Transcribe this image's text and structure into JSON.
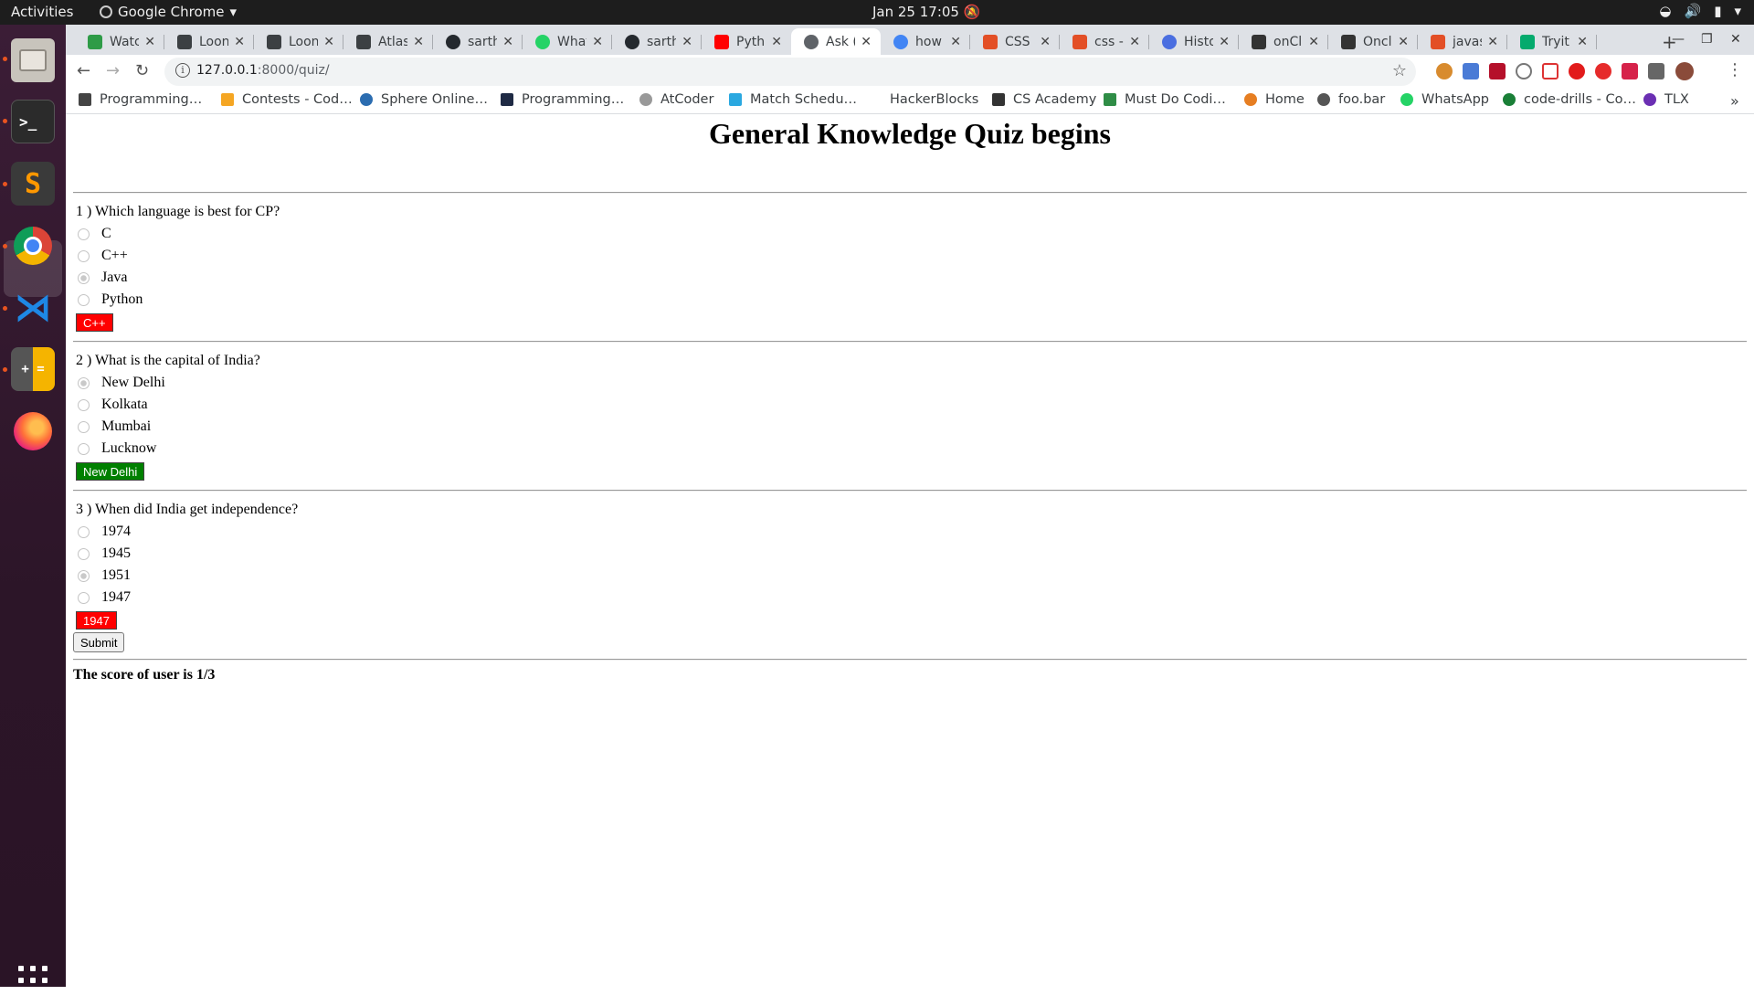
{
  "system": {
    "activities": "Activities",
    "app_name": "Google Chrome",
    "clock": "Jan 25  17:05"
  },
  "tabs": [
    {
      "title": "Watc",
      "color": "#2e9b47"
    },
    {
      "title": "Loon",
      "color": "#3c4043"
    },
    {
      "title": "Loon",
      "color": "#3c4043"
    },
    {
      "title": "Atlas",
      "color": "#3c4043"
    },
    {
      "title": "sarth",
      "color": "#24292e"
    },
    {
      "title": "What",
      "color": "#25d366"
    },
    {
      "title": "sarth",
      "color": "#24292e"
    },
    {
      "title": "Pyth",
      "color": "#ff0000"
    },
    {
      "title": "Ask (",
      "color": "#5f6368"
    },
    {
      "title": "how",
      "color": "#4285f4"
    },
    {
      "title": "CSS c",
      "color": "#e34f26"
    },
    {
      "title": "css -",
      "color": "#e34f26"
    },
    {
      "title": "Histo",
      "color": "#4a6ee0"
    },
    {
      "title": "onCl",
      "color": "#333333"
    },
    {
      "title": "Oncl",
      "color": "#333333"
    },
    {
      "title": "javas",
      "color": "#e34f26"
    },
    {
      "title": "Tryit",
      "color": "#04aa6d"
    }
  ],
  "address": {
    "host": "127.0.0.1",
    "rest": ":8000/quiz/"
  },
  "bookmarks": [
    {
      "label": "Programming…",
      "color": "#444"
    },
    {
      "label": "Contests - Cod…",
      "color": "#f5a623"
    },
    {
      "label": "Sphere Online…",
      "color": "#2b6cb0"
    },
    {
      "label": "Programming…",
      "color": "#1f2a44"
    },
    {
      "label": "AtCoder",
      "color": "#777"
    },
    {
      "label": "Match Schedu…",
      "color": "#2aa8e0"
    },
    {
      "label": "HackerBlocks",
      "color": "#ffffff"
    },
    {
      "label": "CS Academy",
      "color": "#333"
    },
    {
      "label": "Must Do Codi…",
      "color": "#2f8d46"
    },
    {
      "label": "Home",
      "color": "#e67e22"
    },
    {
      "label": "foo.bar",
      "color": "#555"
    },
    {
      "label": "WhatsApp",
      "color": "#25d366"
    },
    {
      "label": "code-drills - Co…",
      "color": "#1a7f37"
    },
    {
      "label": "TLX",
      "color": "#6b2fb3"
    }
  ],
  "quiz": {
    "heading": "General Knowledge Quiz begins",
    "questions": [
      {
        "text": "1 ) Which language is best for CP?",
        "options": [
          "C",
          "C++",
          "Java",
          "Python"
        ],
        "selected": 2,
        "answer": "C++",
        "correct": false
      },
      {
        "text": "2 ) What is the capital of India?",
        "options": [
          "New Delhi",
          "Kolkata",
          "Mumbai",
          "Lucknow"
        ],
        "selected": 0,
        "answer": "New Delhi",
        "correct": true
      },
      {
        "text": "3 ) When did India get independence?",
        "options": [
          "1974",
          "1945",
          "1951",
          "1947"
        ],
        "selected": 2,
        "answer": "1947",
        "correct": false
      }
    ],
    "submit_label": "Submit",
    "score_text": "The score of user is 1/3"
  }
}
